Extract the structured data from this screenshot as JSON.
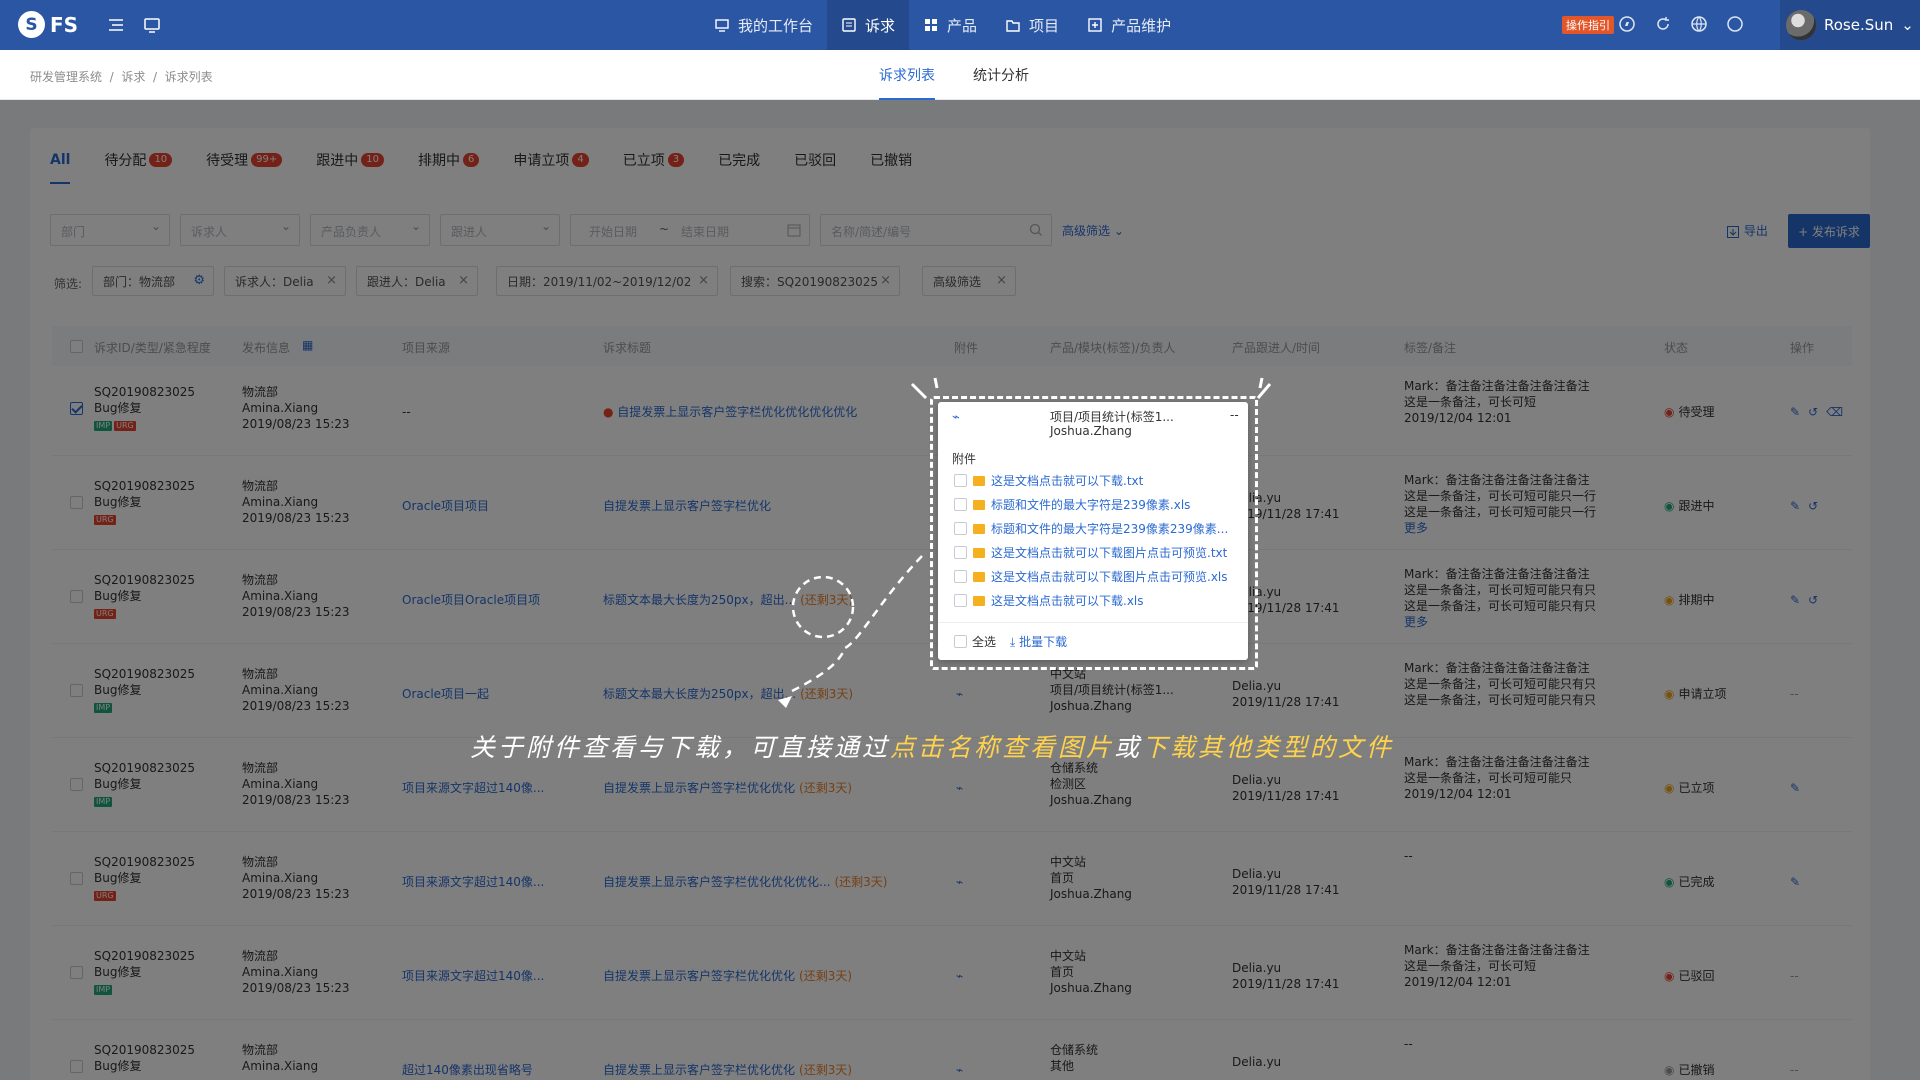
{
  "app": {
    "logo_text": "FS"
  },
  "nav": [
    {
      "label": "我的工作台",
      "icon": "monitor-icon"
    },
    {
      "label": "诉求",
      "icon": "request-icon"
    },
    {
      "label": "产品",
      "icon": "grid-icon"
    },
    {
      "label": "项目",
      "icon": "folder-icon"
    },
    {
      "label": "产品维护",
      "icon": "plus-box-icon"
    }
  ],
  "guide_label": "操作指引",
  "user_name": "Rose.Sun",
  "breadcrumb": [
    "研发管理系统",
    "诉求",
    "诉求列表"
  ],
  "subtabs": [
    "诉求列表",
    "统计分析"
  ],
  "status_tabs": [
    {
      "label": "All"
    },
    {
      "label": "待分配",
      "badge": "10"
    },
    {
      "label": "待受理",
      "badge": "99+"
    },
    {
      "label": "跟进中",
      "badge": "10"
    },
    {
      "label": "排期中",
      "badge": "6"
    },
    {
      "label": "申请立项",
      "badge": "4"
    },
    {
      "label": "已立项",
      "badge": "3"
    },
    {
      "label": "已完成"
    },
    {
      "label": "已驳回"
    },
    {
      "label": "已撤销"
    }
  ],
  "filters": {
    "dept": "部门",
    "requester": "诉求人",
    "product_owner": "产品负责人",
    "follower": "跟进人",
    "start_date": "开始日期",
    "date_sep": "~",
    "end_date": "结束日期",
    "search_placeholder": "名称/简述/编号",
    "advanced": "高级筛选 ⌄",
    "export": "导出",
    "publish": "+ 发布诉求"
  },
  "chips_label": "筛选:",
  "chips": [
    "部门：物流部",
    "诉求人：Delia",
    "跟进人：Delia",
    "日期：2019/11/02~2019/12/02",
    "搜索：SQ20190823025",
    "高级筛选"
  ],
  "columns": [
    "诉求ID/类型/紧急程度",
    "发布信息",
    "项目来源",
    "诉求标题",
    "附件",
    "产品/模块(标签)/负责人",
    "产品跟进人/时间",
    "标签/备注",
    "状态",
    "操作"
  ],
  "rows": [
    {
      "id": "SQ20190823025",
      "type": "Bug修复",
      "tags": [
        [
          "IMP",
          "green"
        ],
        [
          "URG",
          "red"
        ]
      ],
      "dept": "物流部",
      "person": "Amina.Xiang",
      "date": "2019/08/23 15:23",
      "source": "--",
      "source_link": false,
      "title": "自提发票上显示客户签字栏优化优化优化优化",
      "title_dot": true,
      "title_extra": "",
      "attach": true,
      "prod1": "",
      "prod2": "",
      "prod3": "",
      "follow1": "",
      "follow2": "",
      "note1": "Mark：备注备注备注备注备注备注",
      "note2": "这是一条备注，可长可短",
      "note3": "2019/12/04 12:01",
      "note4": "",
      "status": "待受理",
      "status_color": "#e8432e",
      "checked": true,
      "ops": 3
    },
    {
      "id": "SQ20190823025",
      "type": "Bug修复",
      "tags": [
        [
          "URG",
          "red"
        ]
      ],
      "dept": "物流部",
      "person": "Amina.Xiang",
      "date": "2019/08/23 15:23",
      "source": "Oracle项目项目",
      "source_link": true,
      "title": "自提发票上显示客户签字栏优化",
      "title_dot": false,
      "title_extra": "",
      "attach": false,
      "prod1": "",
      "prod2": "",
      "prod3": "",
      "follow1": "Delia.yu",
      "follow2": "2019/11/28 17:41",
      "note1": "Mark：备注备注备注备注备注备注",
      "note2": "这是一条备注，可长可短可能只一行",
      "note3": "这是一条备注，可长可短可能只一行",
      "note4": "更多",
      "status": "跟进中",
      "status_color": "#1fa87a",
      "checked": false,
      "ops": 2
    },
    {
      "id": "SQ20190823025",
      "type": "Bug修复",
      "tags": [
        [
          "URG",
          "red"
        ]
      ],
      "dept": "物流部",
      "person": "Amina.Xiang",
      "date": "2019/08/23 15:23",
      "source": "Oracle项目Oracle项目项",
      "source_link": true,
      "title": "标题文本最大长度为250px，超出...",
      "title_dot": false,
      "title_extra": "(还剩3天)",
      "attach": false,
      "prod1": "",
      "prod2": "",
      "prod3": "",
      "follow1": "Delia.yu",
      "follow2": "2019/11/28 17:41",
      "note1": "Mark：备注备注备注备注备注备注",
      "note2": "这是一条备注，可长可短可能只有只",
      "note3": "这是一条备注，可长可短可能只有只",
      "note4": "更多",
      "status": "排期中",
      "status_color": "#f0a020",
      "checked": false,
      "ops": 2
    },
    {
      "id": "SQ20190823025",
      "type": "Bug修复",
      "tags": [
        [
          "IMP",
          "green"
        ]
      ],
      "dept": "物流部",
      "person": "Amina.Xiang",
      "date": "2019/08/23 15:23",
      "source": "Oracle项目一起",
      "source_link": true,
      "title": "标题文本最大长度为250px，超出...",
      "title_dot": false,
      "title_extra": "(还剩3天)",
      "attach": true,
      "prod1": "中文站",
      "prod2": "项目/项目统计(标签1...",
      "prod3": "Joshua.Zhang",
      "follow1": "Delia.yu",
      "follow2": "2019/11/28 17:41",
      "note1": "Mark：备注备注备注备注备注备注",
      "note2": "这是一条备注，可长可短可能只有只",
      "note3": "这是一条备注，可长可短可能只有只",
      "note4": "",
      "status": "申请立项",
      "status_color": "#f0a020",
      "checked": false,
      "ops": 0
    },
    {
      "id": "SQ20190823025",
      "type": "Bug修复",
      "tags": [
        [
          "IMP",
          "green"
        ]
      ],
      "dept": "物流部",
      "person": "Amina.Xiang",
      "date": "2019/08/23 15:23",
      "source": "项目来源文字超过140像...",
      "source_link": true,
      "title": "自提发票上显示客户签字栏优化优化",
      "title_dot": false,
      "title_extra": "(还剩3天)",
      "attach": true,
      "prod1": "仓储系统",
      "prod2": "检测区",
      "prod3": "Joshua.Zhang",
      "follow1": "Delia.yu",
      "follow2": "2019/11/28 17:41",
      "note1": "Mark：备注备注备注备注备注备注",
      "note2": "这是一条备注，可长可短可能只",
      "note3": "2019/12/04 12:01",
      "note4": "",
      "status": "已立项",
      "status_color": "#f0a020",
      "checked": false,
      "ops": 1
    },
    {
      "id": "SQ20190823025",
      "type": "Bug修复",
      "tags": [
        [
          "URG",
          "red"
        ]
      ],
      "dept": "物流部",
      "person": "Amina.Xiang",
      "date": "2019/08/23 15:23",
      "source": "项目来源文字超过140像...",
      "source_link": true,
      "title": "自提发票上显示客户签字栏优化优化优化...",
      "title_dot": false,
      "title_extra": "(还剩3天)",
      "attach": true,
      "prod1": "中文站",
      "prod2": "首页",
      "prod3": "Joshua.Zhang",
      "follow1": "Delia.yu",
      "follow2": "2019/11/28 17:41",
      "note1": "--",
      "note2": "",
      "note3": "",
      "note4": "",
      "status": "已完成",
      "status_color": "#1fa87a",
      "checked": false,
      "ops": 1
    },
    {
      "id": "SQ20190823025",
      "type": "Bug修复",
      "tags": [
        [
          "IMP",
          "green"
        ]
      ],
      "dept": "物流部",
      "person": "Amina.Xiang",
      "date": "2019/08/23 15:23",
      "source": "项目来源文字超过140像...",
      "source_link": true,
      "title": "自提发票上显示客户签字栏优化优化",
      "title_dot": false,
      "title_extra": "(还剩3天)",
      "attach": true,
      "prod1": "中文站",
      "prod2": "首页",
      "prod3": "Joshua.Zhang",
      "follow1": "Delia.yu",
      "follow2": "2019/11/28 17:41",
      "note1": "Mark：备注备注备注备注备注备注",
      "note2": "这是一条备注，可长可短",
      "note3": "2019/12/04 12:01",
      "note4": "",
      "status": "已驳回",
      "status_color": "#e8432e",
      "checked": false,
      "ops": 0
    },
    {
      "id": "SQ20190823025",
      "type": "Bug修复",
      "tags": [],
      "dept": "物流部",
      "person": "Amina.Xiang",
      "date": "",
      "source": "超过140像素出现省略号",
      "source_link": true,
      "title": "自提发票上显示客户签字栏优化优化",
      "title_dot": false,
      "title_extra": "(还剩3天)",
      "attach": true,
      "prod1": "仓储系统",
      "prod2": "其他",
      "prod3": "",
      "follow1": "Delia.yu",
      "follow2": "",
      "note1": "--",
      "note2": "",
      "note3": "",
      "note4": "",
      "status": "已撤销",
      "status_color": "#999999",
      "checked": false,
      "ops": 0
    }
  ],
  "popup": {
    "header_label": "附件",
    "files": [
      {
        "name": "这是文档点击就可以下载.txt"
      },
      {
        "name": "标题和文件的最大字符是239像素.xls"
      },
      {
        "name": "标题和文件的最大字符是239像素239像素..."
      },
      {
        "name": "这是文档点击就可以下载图片点击可预览.txt"
      },
      {
        "name": "这是文档点击就可以下载图片点击可预览.xls"
      },
      {
        "name": "这是文档点击就可以下载.xls"
      }
    ],
    "select_all": "全选",
    "batch_download": "批量下载",
    "peek_prod": "项目/项目统计(标签1...",
    "peek_owner": "Joshua.Zhang",
    "peek_dash": "--"
  },
  "caption_part1": "关于附件查看与下载，可直接通过",
  "caption_hl1": "点击名称查看图片",
  "caption_part2": "或",
  "caption_hl2": "下载其他类型的文件",
  "colors": {
    "nav_bg": "#2a56a3",
    "accent": "#2b6ad1",
    "badge": "#e8432e",
    "highlight": "#ffd24c"
  }
}
